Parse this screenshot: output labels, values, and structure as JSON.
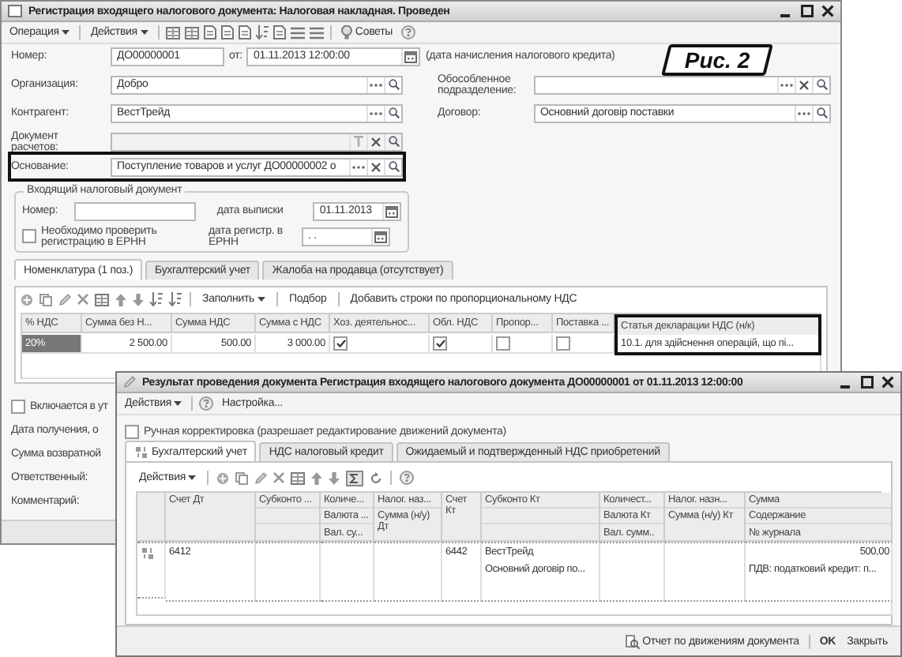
{
  "main_window": {
    "title": "Регистрация входящего налогового документа: Налоговая накладная. Проведен",
    "menus": [
      "Операция",
      "Действия"
    ],
    "advice_button": "Советы",
    "number": {
      "label": "Номер:",
      "value": "ДО00000001"
    },
    "date": {
      "label": "от:",
      "value": "01.11.2013 12:00:00",
      "note": "(дата начисления налогового кредита)"
    },
    "left_fields": [
      {
        "label": "Организация:",
        "value": "Добро",
        "disabled": false,
        "highlighted": false
      },
      {
        "label": "Контрагент:",
        "value": "ВестТрейд",
        "disabled": false,
        "highlighted": false
      },
      {
        "label": "Документ расчетов:",
        "disabled": true,
        "highlighted": false
      },
      {
        "label": "Основание:",
        "value": "Поступление товаров и услуг ДО00000002 о",
        "disabled": false,
        "highlighted": true
      }
    ],
    "right_fields": [
      {
        "label": "Обособленное подразделение:"
      },
      {
        "label": "Договор:",
        "value": "Основний договір поставки"
      }
    ],
    "incoming_document": {
      "title": "Входящий налоговый документ",
      "number_label": "Номер:",
      "issue_date_label": "дата выписки",
      "issue_date": "01.11.2013",
      "check": {
        "label": "Необходимо проверить регистрацию в ЕРНН",
        "checked": false
      },
      "reg_date_label": "дата регистр. в ЕРНН",
      "reg_date": ". ."
    },
    "tabs": [
      {
        "label": "Номенклатура (1 поз.)",
        "selected": true
      },
      {
        "label": "Бухгалтерский учет",
        "selected": false
      },
      {
        "label": "Жалоба на продавца (отсутствует)",
        "selected": false
      }
    ],
    "table_toolbar": {
      "fill": "Заполнить",
      "pick": "Подбор",
      "add_rows": "Добавить строки по пропорциональному НДС"
    },
    "table": {
      "columns": [
        {
          "label": "% НДС",
          "kind": "text",
          "highlighted": false
        },
        {
          "label": "Сумма без Н...",
          "kind": "number",
          "highlighted": false
        },
        {
          "label": "Сумма НДС",
          "kind": "number",
          "highlighted": false
        },
        {
          "label": "Сумма с НДС",
          "kind": "number",
          "highlighted": false
        },
        {
          "label": "Хоз. деятельнос...",
          "kind": "check",
          "highlighted": false
        },
        {
          "label": "Обл. НДС",
          "kind": "check",
          "highlighted": false
        },
        {
          "label": "Пропор...",
          "kind": "check",
          "highlighted": false
        },
        {
          "label": "Поставка ...",
          "kind": "check",
          "highlighted": false
        },
        {
          "label": "Статья декларации НДС (н/к)",
          "kind": "text",
          "highlighted": true
        }
      ],
      "rows": [
        {
          "cells": [
            {
              "text": "20%",
              "selected": true
            },
            {
              "text": "2 500.00",
              "selected": false
            },
            {
              "text": "500.00",
              "selected": false
            },
            {
              "text": "3 000.00",
              "selected": false
            },
            {
              "checked": true,
              "selected": false
            },
            {
              "checked": true,
              "selected": false
            },
            {
              "checked": false,
              "selected": false
            },
            {
              "checked": false,
              "selected": false
            },
            {
              "text": "10.1. для здійснення операцій, що пі...",
              "selected": false
            }
          ]
        }
      ]
    },
    "bottom_fields": [
      {
        "kind": "check",
        "label": "Включается в ут",
        "checked": false
      },
      {
        "kind": "label",
        "label": "Дата получения, о"
      },
      {
        "kind": "label",
        "label": "Сумма возвратной"
      },
      {
        "kind": "label",
        "label": "Ответственный:"
      },
      {
        "kind": "label",
        "label": "Комментарий:"
      }
    ]
  },
  "result_window": {
    "title": "Результат проведения документа Регистрация входящего налогового документа ДО00000001 от 01.11.2013 12:00:00",
    "menu": "Действия",
    "settings": "Настройка...",
    "manual": {
      "label": "Ручная корректировка (разрешает редактирование движений документа)",
      "checked": false
    },
    "tabs": [
      {
        "label": "Бухгалтерский учет",
        "selected": true
      },
      {
        "label": "НДС налоговый кредит",
        "selected": false
      },
      {
        "label": "Ожидаемый и подтвержденный НДС приобретений",
        "selected": false
      }
    ],
    "table_menu": "Действия",
    "columns": [
      {
        "kind": "merged",
        "lines": [
          "Счет Дт"
        ]
      },
      {
        "kind": "split3",
        "lines": [
          "Субконто ..."
        ]
      },
      {
        "kind": "split3",
        "lines": [
          "Количе...",
          "Валюта ...",
          "Вал. су..."
        ]
      },
      {
        "kind": "split2",
        "lines": [
          "Налог. наз...",
          "Сумма (н/у) Дт"
        ]
      },
      {
        "kind": "merged",
        "lines": [
          "Счет Кт"
        ]
      },
      {
        "kind": "split3",
        "lines": [
          "Субконто Кт"
        ]
      },
      {
        "kind": "split3",
        "lines": [
          "Количест...",
          "Валюта Кт",
          "Вал. сумм.."
        ]
      },
      {
        "kind": "split2",
        "lines": [
          "Налог. назн...",
          "Сумма (н/у) Кт"
        ]
      },
      {
        "kind": "amount",
        "lines": [
          "Сумма",
          "Содержание",
          "№ журнала"
        ]
      }
    ],
    "rows": [
      {
        "cells": [
          {
            "lines": [
              "6412"
            ]
          },
          {},
          {},
          {},
          {
            "lines": [
              "6442"
            ]
          },
          {
            "lines": [
              "ВестТрейд",
              "Основний договір по..."
            ]
          },
          {},
          {},
          {
            "lines": [
              "500,00",
              "ПДВ: податковий кредит: п..."
            ]
          }
        ]
      }
    ],
    "report_button": "Отчет по движениям документа",
    "ok_button": "OK",
    "close_button": "Закрыть"
  },
  "annotation": {
    "label": "Рис. 2"
  }
}
